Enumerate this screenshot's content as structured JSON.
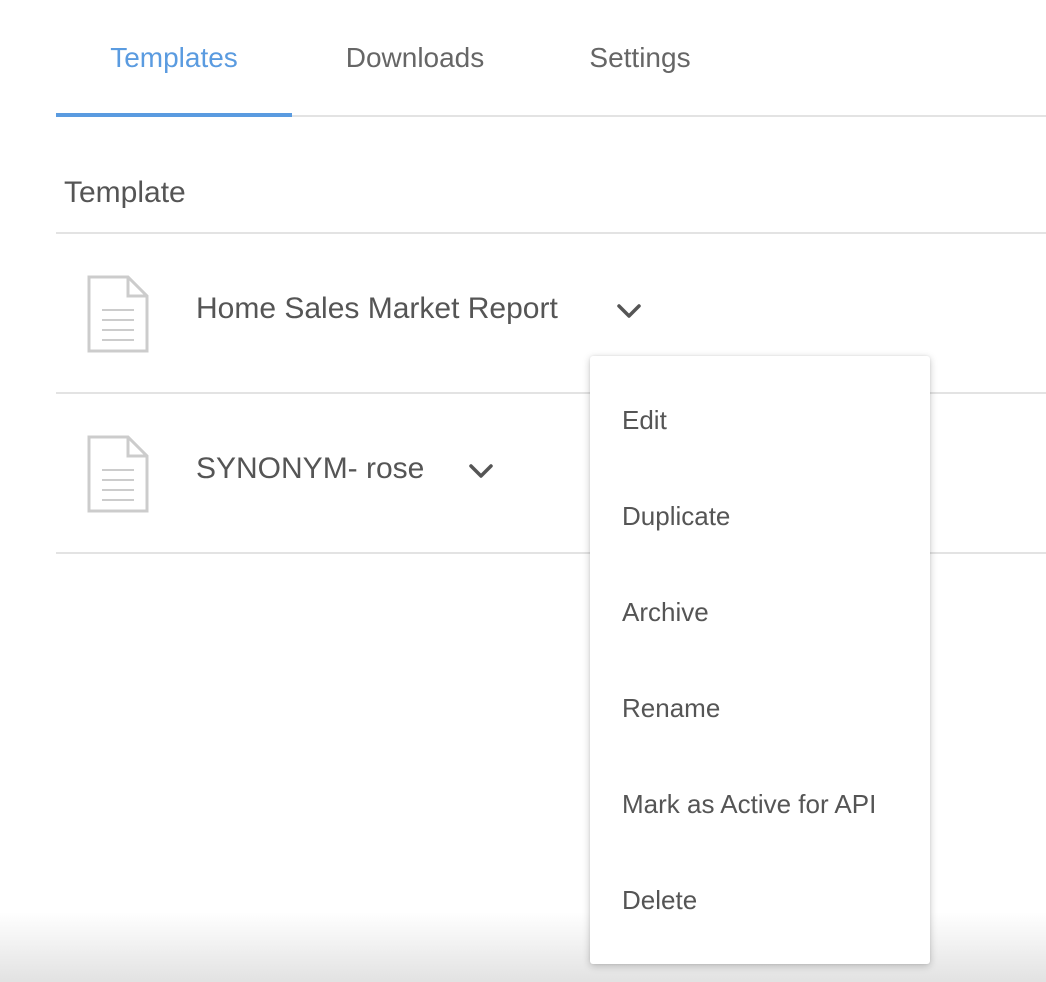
{
  "tabs": [
    {
      "label": "Templates",
      "active": true
    },
    {
      "label": "Downloads",
      "active": false
    },
    {
      "label": "Settings",
      "active": false
    }
  ],
  "accent_color": "#5a9be0",
  "section": {
    "header": "Template"
  },
  "templates": [
    {
      "name": "Home Sales Market Report",
      "icon": "document-icon",
      "menu_icon": "chevron-down-icon"
    },
    {
      "name": "SYNONYM- rose",
      "icon": "document-icon",
      "menu_icon": "chevron-down-icon"
    }
  ],
  "context_menu": {
    "items": [
      {
        "label": "Edit"
      },
      {
        "label": "Duplicate"
      },
      {
        "label": "Archive"
      },
      {
        "label": "Rename"
      },
      {
        "label": "Mark as Active for API"
      },
      {
        "label": "Delete"
      }
    ]
  }
}
